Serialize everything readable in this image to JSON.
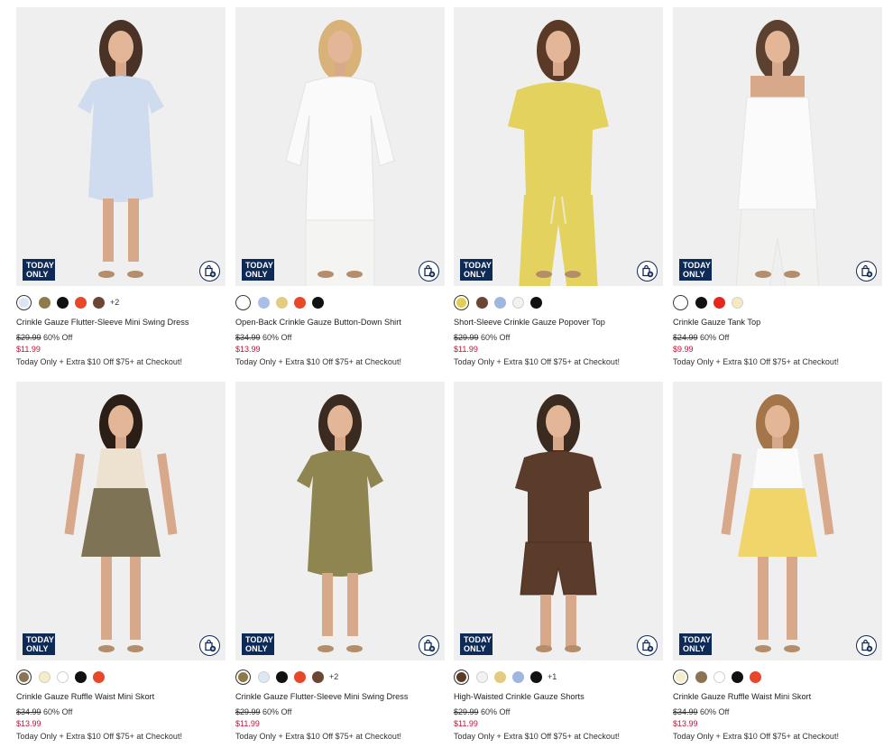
{
  "badge": {
    "line1": "TODAY",
    "line2": "ONLY"
  },
  "products": [
    {
      "name": "Crinkle Gauze Flutter-Sleeve Mini Swing Dress",
      "original_price": "$29.99",
      "discount": "60% Off",
      "sale_price": "$11.99",
      "promo": "Today Only + Extra $10 Off $75+ at Checkout!",
      "swatches": [
        "#dce6f3",
        "#8f7a4a",
        "#111111",
        "#e8472a",
        "#6b4634"
      ],
      "selected_swatch": 0,
      "more_colors": "+2",
      "garment_color": "#cfdcf0",
      "bottom_color": "#cfdcf0",
      "style": "dress"
    },
    {
      "name": "Open-Back Crinkle Gauze Button-Down Shirt",
      "original_price": "$34.99",
      "discount": "60% Off",
      "sale_price": "$13.99",
      "promo": "Today Only + Extra $10 Off $75+ at Checkout!",
      "swatches": [
        "#ffffff",
        "#a9bfe6",
        "#e3cb80",
        "#e8472a",
        "#111111"
      ],
      "selected_swatch": 0,
      "more_colors": "",
      "garment_color": "#fafafa",
      "bottom_color": "#f4f4f2",
      "style": "shirt"
    },
    {
      "name": "Short-Sleeve Crinkle Gauze Popover Top",
      "original_price": "$29.99",
      "discount": "60% Off",
      "sale_price": "$11.99",
      "promo": "Today Only + Extra $10 Off $75+ at Checkout!",
      "swatches": [
        "#e2cf55",
        "#6b4634",
        "#9fb6e0",
        "#f2f2f2",
        "#111111"
      ],
      "selected_swatch": 0,
      "more_colors": "",
      "garment_color": "#e3d35e",
      "bottom_color": "#e3d35e",
      "style": "top"
    },
    {
      "name": "Crinkle Gauze Tank Top",
      "original_price": "$24.99",
      "discount": "60% Off",
      "sale_price": "$9.99",
      "promo": "Today Only + Extra $10 Off $75+ at Checkout!",
      "swatches": [
        "#ffffff",
        "#111111",
        "#e8251f",
        "#f6e8c0"
      ],
      "selected_swatch": 0,
      "more_colors": "",
      "garment_color": "#fbfbfb",
      "bottom_color": "#f1f1ef",
      "style": "tank"
    },
    {
      "name": "Crinkle Gauze Ruffle Waist Mini Skort",
      "original_price": "$34.99",
      "discount": "60% Off",
      "sale_price": "$13.99",
      "promo": "Today Only + Extra $10 Off $75+ at Checkout!",
      "swatches": [
        "#8a7453",
        "#f6ecc6",
        "#ffffff",
        "#111111",
        "#e8472a"
      ],
      "selected_swatch": 0,
      "more_colors": "",
      "garment_color": "#ece2cf",
      "bottom_color": "#7f7356",
      "style": "skort"
    },
    {
      "name": "Crinkle Gauze Flutter-Sleeve Mini Swing Dress",
      "original_price": "$29.99",
      "discount": "60% Off",
      "sale_price": "$11.99",
      "promo": "Today Only + Extra $10 Off $75+ at Checkout!",
      "swatches": [
        "#8c7a49",
        "#dde8f5",
        "#111111",
        "#e8472a",
        "#6b4634"
      ],
      "selected_swatch": 0,
      "more_colors": "+2",
      "garment_color": "#8e8550",
      "bottom_color": "#8e8550",
      "style": "dress"
    },
    {
      "name": "High-Waisted Crinkle Gauze Shorts",
      "original_price": "$29.99",
      "discount": "60% Off",
      "sale_price": "$11.99",
      "promo": "Today Only + Extra $10 Off $75+ at Checkout!",
      "swatches": [
        "#5a3a2a",
        "#f2f2f2",
        "#e3cb80",
        "#9fb6e0",
        "#111111"
      ],
      "selected_swatch": 0,
      "more_colors": "+1",
      "garment_color": "#5b3b2a",
      "bottom_color": "#5b3b2a",
      "style": "shorts"
    },
    {
      "name": "Crinkle Gauze Ruffle Waist Mini Skort",
      "original_price": "$34.99",
      "discount": "60% Off",
      "sale_price": "$13.99",
      "promo": "Today Only + Extra $10 Off $75+ at Checkout!",
      "swatches": [
        "#f6ecc6",
        "#8a7453",
        "#ffffff",
        "#111111",
        "#e8472a"
      ],
      "selected_swatch": 0,
      "more_colors": "",
      "garment_color": "#fbfbfb",
      "bottom_color": "#f0d66a",
      "style": "skort"
    }
  ]
}
